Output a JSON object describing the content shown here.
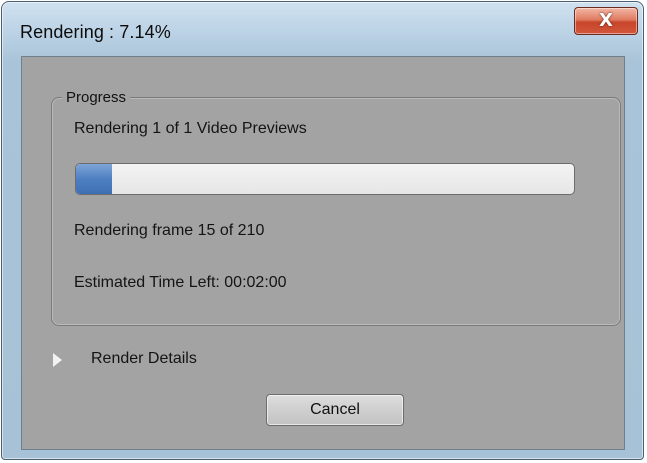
{
  "window": {
    "title": "Rendering : 7.14%",
    "close_icon": "close-x-icon",
    "close_glyph": "X"
  },
  "progress_group": {
    "label": "Progress",
    "rendering_line": "Rendering 1 of 1 Video Previews",
    "frame_line": "Rendering frame 15 of 210",
    "time_left_line": "Estimated Time Left: 00:02:00",
    "progress_fraction": 0.0714,
    "progress_color": "#4e7fc2"
  },
  "render_details": {
    "label": "Render Details",
    "icon": "disclosure-triangle-icon"
  },
  "buttons": {
    "cancel_label": "Cancel"
  }
}
